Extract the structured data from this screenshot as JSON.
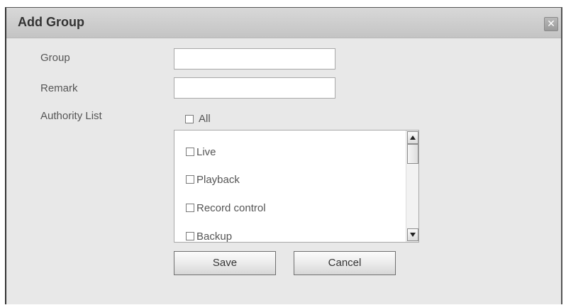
{
  "dialog": {
    "title": "Add Group",
    "close_glyph": "✕"
  },
  "form": {
    "group_label": "Group",
    "group_value": "",
    "remark_label": "Remark",
    "remark_value": "",
    "authority_label": "Authority List",
    "all_label": "All"
  },
  "authority_list": {
    "items": [
      {
        "label": "Live",
        "checked": false
      },
      {
        "label": "Playback",
        "checked": false
      },
      {
        "label": "Record control",
        "checked": false
      },
      {
        "label": "Backup",
        "checked": false
      }
    ]
  },
  "buttons": {
    "save_label": "Save",
    "cancel_label": "Cancel"
  },
  "icons": {
    "close": "close-icon",
    "scroll_up": "scroll-up-arrow-icon",
    "scroll_down": "scroll-down-arrow-icon"
  }
}
